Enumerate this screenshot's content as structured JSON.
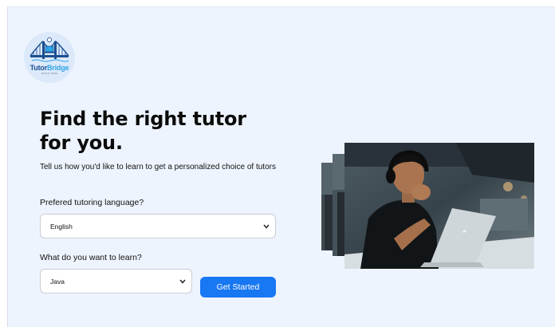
{
  "logo": {
    "name_part1": "Tutor",
    "name_part2": "Bridge",
    "tagline": "TEACH HERE"
  },
  "hero": {
    "headline": "Find the right tutor for you.",
    "subtitle": "Tell us how you'd like to learn to get a personalized choice of tutors"
  },
  "form": {
    "language_label": "Prefered tutoring language?",
    "language_value": "English",
    "learn_label": "What do you want to learn?",
    "learn_value": "Java",
    "submit_label": "Get Started"
  },
  "colors": {
    "accent": "#1877f2",
    "background": "#eef4fd",
    "logo_navy": "#1d4f91",
    "logo_sky": "#2fa4e7"
  },
  "icons": {
    "select_arrow": "chevron-down-icon",
    "logo_mark": "bridge-icon"
  }
}
